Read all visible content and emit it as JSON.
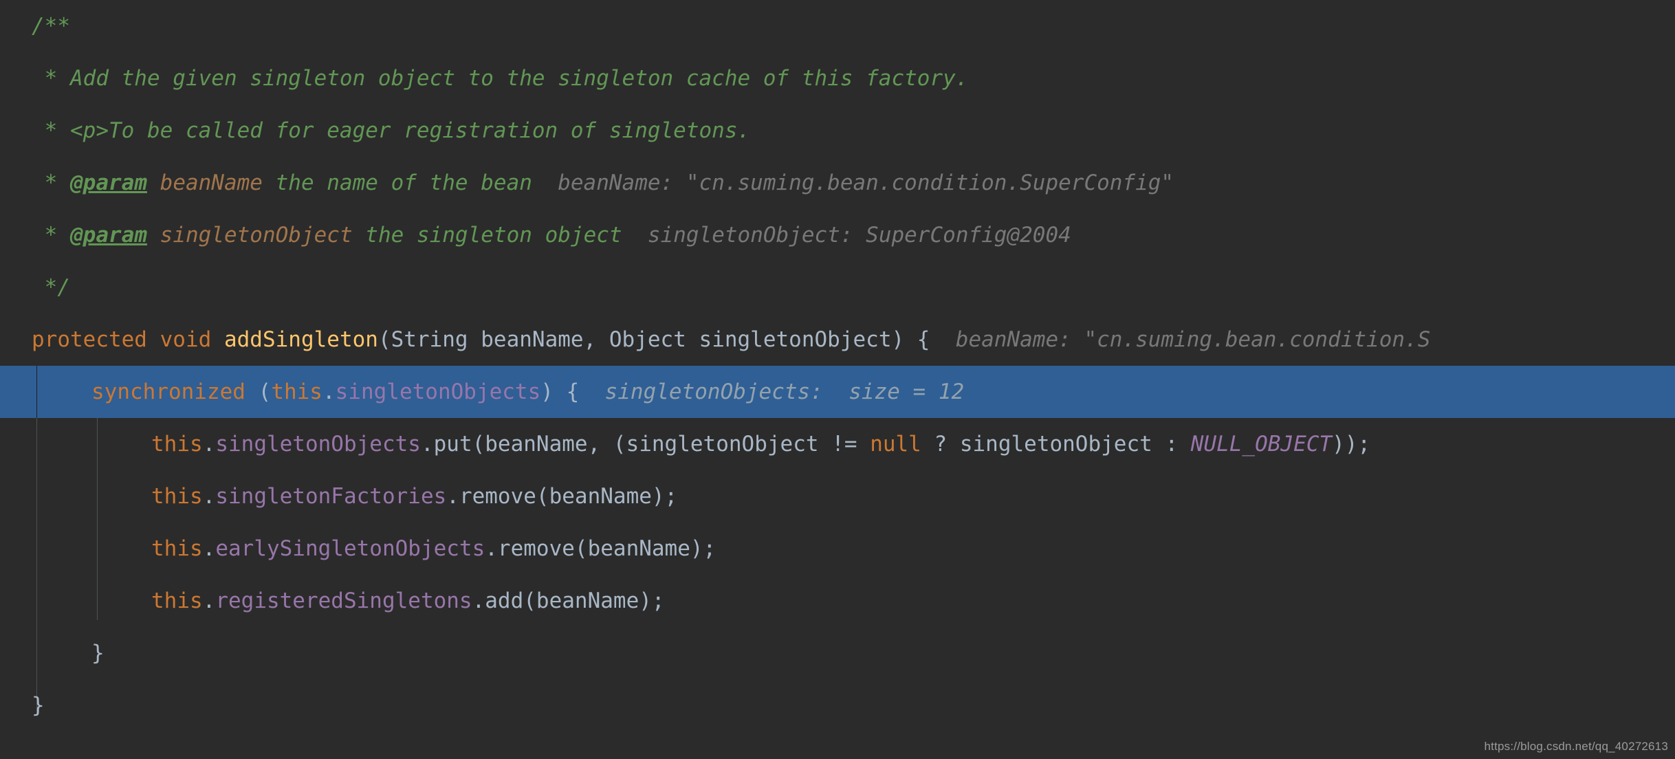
{
  "editor": {
    "theme": "darcula",
    "background_color": "#2b2b2b",
    "highlight_color": "#2f5f95",
    "indent_guide_color": "#4e5254",
    "language": "java",
    "file_kind": "source-code-editor"
  },
  "colors": {
    "comment": "#629755",
    "comment_param_name": "#a1754c",
    "keyword": "#cc7832",
    "method_declaration": "#ffc66d",
    "field": "#9876aa",
    "constant": "#9876aa",
    "plain_text": "#a9b7c6",
    "inline_hint": "#787878",
    "inline_hint_highlighted": "#93a2ad"
  },
  "code": {
    "lines": [
      {
        "id": "line-comment-open",
        "indent": 0,
        "tokens": [
          {
            "kind": "cmt",
            "text": "/**"
          }
        ]
      },
      {
        "id": "line-comment-desc1",
        "indent": 0,
        "tokens": [
          {
            "kind": "cmt",
            "text": " * Add the given singleton object to the singleton cache of this factory."
          }
        ]
      },
      {
        "id": "line-comment-desc2",
        "indent": 0,
        "tokens": [
          {
            "kind": "cmt",
            "text": " * <p>To be called for eager registration of singletons."
          }
        ]
      },
      {
        "id": "line-comment-param-beanname",
        "indent": 0,
        "tokens": [
          {
            "kind": "cmt",
            "text": " * "
          },
          {
            "kind": "cmt-tag",
            "text": "@param"
          },
          {
            "kind": "cmt",
            "text": " "
          },
          {
            "kind": "cmt-par",
            "text": "beanName"
          },
          {
            "kind": "cmt",
            "text": " the name of the bean"
          },
          {
            "kind": "hint",
            "text": "  beanName: \"cn.suming.bean.condition.SuperConfig\""
          }
        ]
      },
      {
        "id": "line-comment-param-singletonobject",
        "indent": 0,
        "tokens": [
          {
            "kind": "cmt",
            "text": " * "
          },
          {
            "kind": "cmt-tag",
            "text": "@param"
          },
          {
            "kind": "cmt",
            "text": " "
          },
          {
            "kind": "cmt-par",
            "text": "singletonObject"
          },
          {
            "kind": "cmt",
            "text": " the singleton object"
          },
          {
            "kind": "hint",
            "text": "  singletonObject: SuperConfig@2004"
          }
        ]
      },
      {
        "id": "line-comment-close",
        "indent": 0,
        "tokens": [
          {
            "kind": "cmt",
            "text": " */"
          }
        ]
      },
      {
        "id": "line-method-signature",
        "indent": 0,
        "tokens": [
          {
            "kind": "kw",
            "text": "protected void "
          },
          {
            "kind": "mdecl",
            "text": "addSingleton"
          },
          {
            "kind": "plain",
            "text": "(String beanName, Object singletonObject) {"
          },
          {
            "kind": "hint",
            "text": "  beanName: \"cn.suming.bean.condition.S"
          }
        ]
      },
      {
        "id": "line-synchronized",
        "indent": 1,
        "highlighted": true,
        "tokens": [
          {
            "kind": "kw",
            "text": "synchronized "
          },
          {
            "kind": "plain",
            "text": "("
          },
          {
            "kind": "kw",
            "text": "this"
          },
          {
            "kind": "plain",
            "text": "."
          },
          {
            "kind": "field",
            "text": "singletonObjects"
          },
          {
            "kind": "plain",
            "text": ") {"
          },
          {
            "kind": "hint-on",
            "text": "  singletonObjects:  size = 12"
          }
        ]
      },
      {
        "id": "line-put-singleton-objects",
        "indent": 2,
        "tokens": [
          {
            "kind": "kw",
            "text": "this"
          },
          {
            "kind": "plain",
            "text": "."
          },
          {
            "kind": "field",
            "text": "singletonObjects"
          },
          {
            "kind": "plain",
            "text": ".put(beanName, (singletonObject != "
          },
          {
            "kind": "kw",
            "text": "null"
          },
          {
            "kind": "plain",
            "text": " ? singletonObject : "
          },
          {
            "kind": "const",
            "text": "NULL_OBJECT"
          },
          {
            "kind": "plain",
            "text": "));"
          }
        ]
      },
      {
        "id": "line-remove-singleton-factories",
        "indent": 2,
        "tokens": [
          {
            "kind": "kw",
            "text": "this"
          },
          {
            "kind": "plain",
            "text": "."
          },
          {
            "kind": "field",
            "text": "singletonFactories"
          },
          {
            "kind": "plain",
            "text": ".remove(beanName);"
          }
        ]
      },
      {
        "id": "line-remove-early-singleton-objects",
        "indent": 2,
        "tokens": [
          {
            "kind": "kw",
            "text": "this"
          },
          {
            "kind": "plain",
            "text": "."
          },
          {
            "kind": "field",
            "text": "earlySingletonObjects"
          },
          {
            "kind": "plain",
            "text": ".remove(beanName);"
          }
        ]
      },
      {
        "id": "line-add-registered-singletons",
        "indent": 2,
        "tokens": [
          {
            "kind": "kw",
            "text": "this"
          },
          {
            "kind": "plain",
            "text": "."
          },
          {
            "kind": "field",
            "text": "registeredSingletons"
          },
          {
            "kind": "plain",
            "text": ".add(beanName);"
          }
        ]
      },
      {
        "id": "line-close-inner-block",
        "indent": 1,
        "tokens": [
          {
            "kind": "brace",
            "text": "}"
          }
        ]
      },
      {
        "id": "line-close-method",
        "indent": 0,
        "tokens": [
          {
            "kind": "brace",
            "text": "}"
          }
        ]
      }
    ]
  },
  "watermark": {
    "text": "https://blog.csdn.net/qq_40272613"
  }
}
